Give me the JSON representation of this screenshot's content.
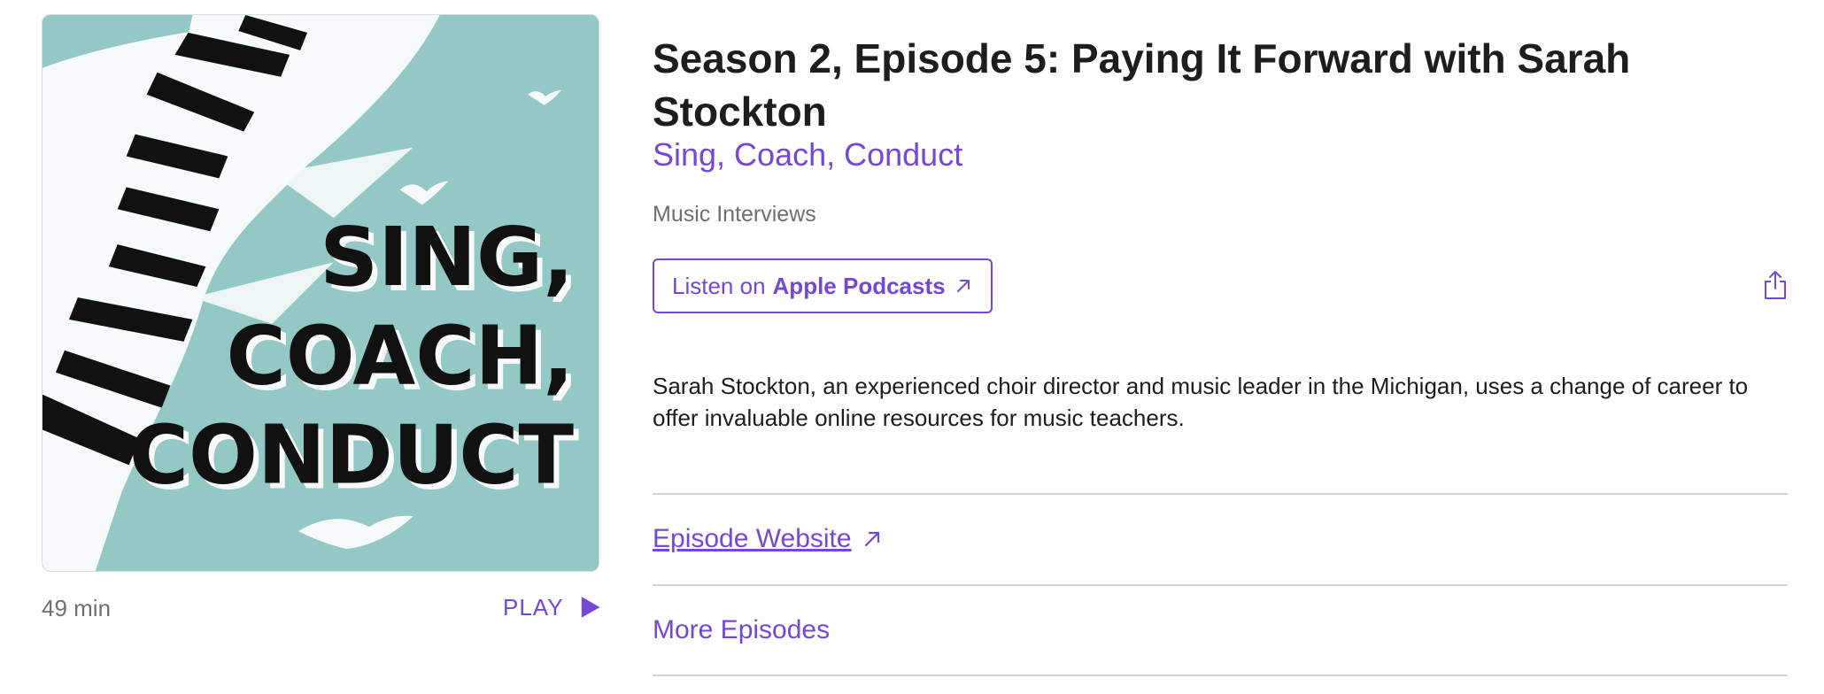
{
  "episode": {
    "title": "Season 2, Episode 5: Paying It Forward with Sarah Stockton",
    "show": "Sing, Coach, Conduct",
    "category": "Music Interviews",
    "duration": "49 min",
    "play_label": "PLAY",
    "description": "Sarah Stockton, an experienced choir director and music leader in the Michigan, uses a change of career to offer invaluable online resources for music teachers."
  },
  "artwork": {
    "lines": [
      "SING,",
      "COACH,",
      "CONDUCT"
    ],
    "background_color": "#93c8c4"
  },
  "listen_button": {
    "prefix": "Listen on",
    "brand": "Apple Podcasts"
  },
  "links": {
    "episode_website": "Episode Website",
    "more_episodes": "More Episodes"
  },
  "icons": {
    "play": "play-icon",
    "share": "share-icon",
    "external": "arrow-up-right-icon"
  },
  "colors": {
    "accent": "#7448d6",
    "secondary_text": "#6e6e73",
    "divider": "#d2d2d7"
  }
}
